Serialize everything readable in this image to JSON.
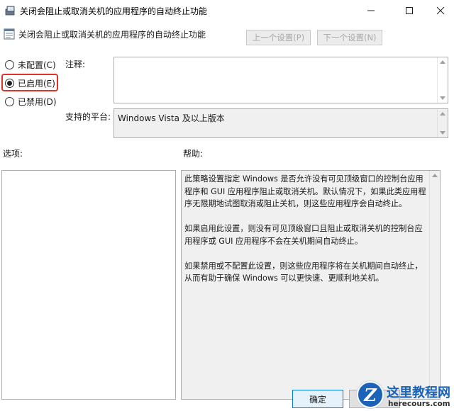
{
  "window": {
    "title": "关闭会阻止或取消关机的应用程序的自动终止功能",
    "icon": "group-policy-icon"
  },
  "header": {
    "title": "关闭会阻止或取消关机的应用程序的自动终止功能",
    "prev_label": "上一个设置(P)",
    "next_label": "下一个设置(N)"
  },
  "options_state": {
    "items": [
      {
        "label": "未配置(C)",
        "checked": false
      },
      {
        "label": "已启用(E)",
        "checked": true
      },
      {
        "label": "已禁用(D)",
        "checked": false
      }
    ],
    "highlight_color": "#e0322c"
  },
  "fields": {
    "comment_label": "注释:",
    "comment_value": "",
    "platform_label": "支持的平台:",
    "platform_value": "Windows Vista 及以上版本"
  },
  "panels": {
    "options_label": "选项:",
    "help_label": "帮助:",
    "help_paragraphs": [
      "此策略设置指定 Windows 是否允许没有可见顶级窗口的控制台应用程序和 GUI 应用程序阻止或取消关机。默认情况下，如果此类应用程序无限期地试图取消或阻止关机，则这些应用程序会自动终止。",
      "如果启用此设置，则没有可见顶级窗口且阻止或取消关机的控制台应用程序或 GUI 应用程序不会在关机期间自动终止。",
      "如果禁用或不配置此设置，则这些应用程序将在关机期间自动终止，从而有助于确保 Windows 可以更快速、更顺利地关机。"
    ]
  },
  "footer": {
    "ok_label": "确定"
  },
  "watermark": {
    "letter": "Z",
    "title": "这里教程网",
    "url": "herecours.com"
  }
}
